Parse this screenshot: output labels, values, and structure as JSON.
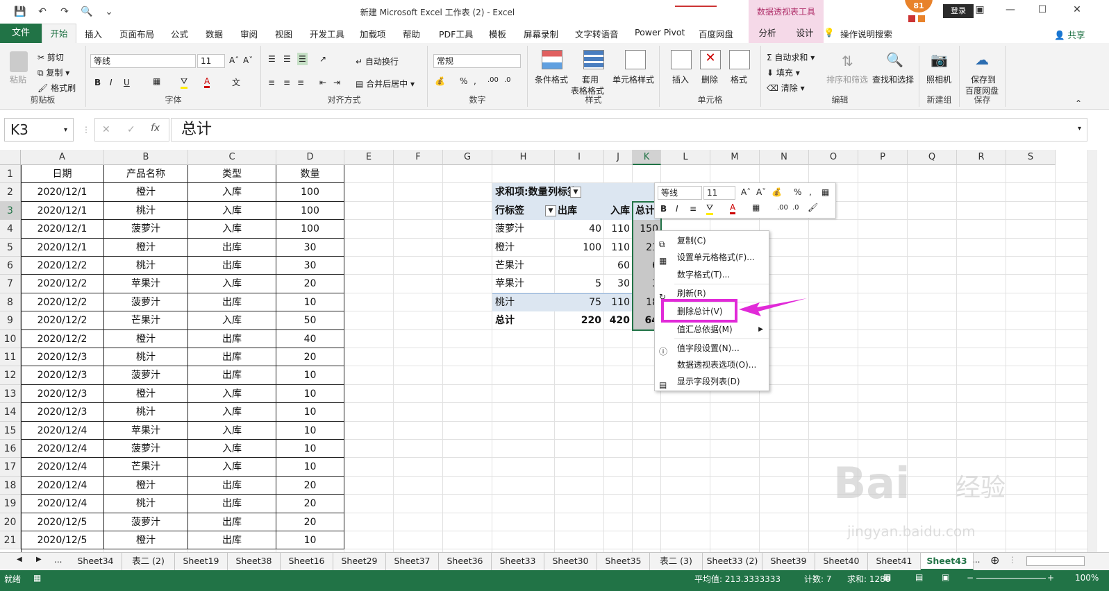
{
  "window": {
    "title": "新建 Microsoft Excel 工作表 (2)  -  Excel",
    "context_tools": "数据透视表工具",
    "badge": "81",
    "login": "登录"
  },
  "tabs": {
    "file": "文件",
    "home": "开始",
    "items": [
      "插入",
      "页面布局",
      "公式",
      "数据",
      "审阅",
      "视图",
      "开发工具",
      "加载项",
      "帮助",
      "PDF工具",
      "模板",
      "屏幕录制",
      "文字转语音",
      "Power Pivot",
      "百度网盘"
    ],
    "ctx": [
      "分析",
      "设计"
    ],
    "tell_me": "操作说明搜索",
    "share": "共享"
  },
  "ribbon": {
    "clipboard": {
      "label": "剪贴板",
      "paste": "粘贴",
      "cut": "剪切",
      "copy": "复制",
      "painter": "格式刷"
    },
    "font": {
      "label": "字体",
      "name": "等线",
      "size": "11"
    },
    "align": {
      "label": "对齐方式",
      "wrap": "自动换行",
      "merge": "合并后居中"
    },
    "number": {
      "label": "数字",
      "format": "常规"
    },
    "styles": {
      "label": "样式",
      "cond": "条件格式",
      "table1": "套用",
      "table2": "表格格式",
      "cell": "单元格样式"
    },
    "cells": {
      "label": "单元格",
      "insert": "插入",
      "delete": "删除",
      "format": "格式"
    },
    "edit": {
      "label": "编辑",
      "autosum": "自动求和",
      "fill": "填充",
      "clear": "清除",
      "sort": "排序和筛选",
      "find": "查找和选择"
    },
    "new_group": {
      "label": "新建组",
      "camera": "照相机"
    },
    "save": {
      "label": "保存",
      "btn1": "保存到",
      "btn2": "百度网盘"
    }
  },
  "formula_bar": {
    "name_box": "K3",
    "formula": "总计"
  },
  "columns": [
    "A",
    "B",
    "C",
    "D",
    "E",
    "F",
    "G",
    "H",
    "I",
    "J",
    "K",
    "L",
    "M",
    "N",
    "O",
    "P",
    "Q",
    "R",
    "S"
  ],
  "rows": [
    "1",
    "2",
    "3",
    "4",
    "5",
    "6",
    "7",
    "8",
    "9",
    "10",
    "11",
    "12",
    "13",
    "14",
    "15",
    "16",
    "17",
    "18",
    "19",
    "20",
    "21"
  ],
  "table": {
    "headers": [
      "日期",
      "产品名称",
      "类型",
      "数量"
    ],
    "data": [
      [
        "2020/12/1",
        "橙汁",
        "入库",
        "100"
      ],
      [
        "2020/12/1",
        "桃汁",
        "入库",
        "100"
      ],
      [
        "2020/12/1",
        "菠萝汁",
        "入库",
        "100"
      ],
      [
        "2020/12/1",
        "橙汁",
        "出库",
        "30"
      ],
      [
        "2020/12/2",
        "桃汁",
        "出库",
        "30"
      ],
      [
        "2020/12/2",
        "苹果汁",
        "入库",
        "20"
      ],
      [
        "2020/12/2",
        "菠萝汁",
        "出库",
        "10"
      ],
      [
        "2020/12/2",
        "芒果汁",
        "入库",
        "50"
      ],
      [
        "2020/12/2",
        "橙汁",
        "出库",
        "40"
      ],
      [
        "2020/12/3",
        "桃汁",
        "出库",
        "20"
      ],
      [
        "2020/12/3",
        "菠萝汁",
        "出库",
        "10"
      ],
      [
        "2020/12/3",
        "橙汁",
        "入库",
        "10"
      ],
      [
        "2020/12/3",
        "桃汁",
        "入库",
        "10"
      ],
      [
        "2020/12/4",
        "苹果汁",
        "入库",
        "10"
      ],
      [
        "2020/12/4",
        "菠萝汁",
        "入库",
        "10"
      ],
      [
        "2020/12/4",
        "芒果汁",
        "入库",
        "10"
      ],
      [
        "2020/12/4",
        "橙汁",
        "出库",
        "20"
      ],
      [
        "2020/12/4",
        "桃汁",
        "出库",
        "20"
      ],
      [
        "2020/12/5",
        "菠萝汁",
        "出库",
        "20"
      ],
      [
        "2020/12/5",
        "橙汁",
        "出库",
        "10"
      ]
    ]
  },
  "pivot": {
    "value_label": "求和项:数量",
    "col_label": "列标签",
    "row_label": "行标签",
    "col_out": "出库",
    "col_in": "入库",
    "col_total": "总计",
    "rows": [
      [
        "菠萝汁",
        "40",
        "110",
        "150"
      ],
      [
        "橙汁",
        "100",
        "110",
        "21"
      ],
      [
        "芒果汁",
        "",
        "60",
        "6"
      ],
      [
        "苹果汁",
        "5",
        "30",
        "3"
      ],
      [
        "桃汁",
        "75",
        "110",
        "18"
      ]
    ],
    "total": [
      "总计",
      "220",
      "420",
      "64"
    ]
  },
  "mini_toolbar": {
    "font": "等线",
    "size": "11",
    "percent": "%",
    "comma": ","
  },
  "context_menu": [
    "复制(C)",
    "设置单元格格式(F)...",
    "数字格式(T)...",
    "刷新(R)",
    "删除总计(V)",
    "值汇总依据(M)",
    "值字段设置(N)...",
    "数据透视表选项(O)...",
    "显示字段列表(D)"
  ],
  "sheet_tabs": [
    "Sheet34",
    "表二 (2)",
    "Sheet19",
    "Sheet38",
    "Sheet16",
    "Sheet29",
    "Sheet37",
    "Sheet36",
    "Sheet33",
    "Sheet30",
    "Sheet35",
    "表二 (3)",
    "Sheet33 (2)",
    "Sheet39",
    "Sheet40",
    "Sheet41",
    "Sheet43"
  ],
  "sheet_more": "...",
  "status": {
    "ready": "就绪",
    "avg": "平均值: 213.3333333",
    "count": "计数: 7",
    "sum": "求和: 1280",
    "zoom": "100%"
  },
  "watermark": {
    "text1": "Bai",
    "text2": "经验",
    "url": "jingyan.baidu.com"
  },
  "colors": {
    "accent": "#217346",
    "highlight": "#e12ad8",
    "pivot_header": "#dce6f1"
  }
}
